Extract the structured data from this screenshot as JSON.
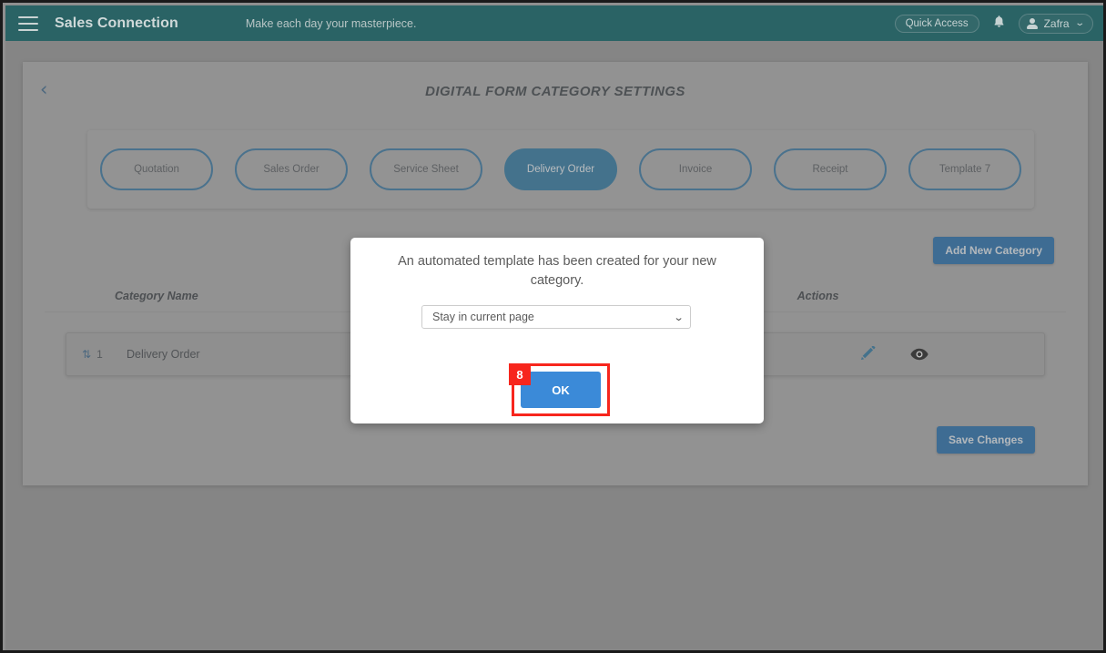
{
  "appbar": {
    "menu_icon": "hamburger-icon",
    "brand": "Sales Connection",
    "tagline": "Make each day your masterpiece.",
    "quick_access_label": "Quick Access",
    "bell_icon": "bell-icon",
    "user_name": "Zafra",
    "user_caret": "⌄",
    "colors": {
      "bar": "#2a6365",
      "text": "#c6d2d2"
    }
  },
  "page": {
    "back_icon": "‹",
    "title": "DIGITAL FORM CATEGORY SETTINGS"
  },
  "categories": {
    "pills": [
      {
        "label": "Quotation",
        "active": false
      },
      {
        "label": "Sales Order",
        "active": false
      },
      {
        "label": "Service Sheet",
        "active": false
      },
      {
        "label": "Delivery Order",
        "active": true
      },
      {
        "label": "Invoice",
        "active": false
      },
      {
        "label": "Receipt",
        "active": false
      },
      {
        "label": "Template 7",
        "active": false
      }
    ],
    "accent_color": "#1f6e9c"
  },
  "toolbar": {
    "add_new_category_label": "Add New Category",
    "save_changes_label": "Save Changes",
    "button_color": "#1565a8"
  },
  "table": {
    "headers": {
      "category_name": "Category Name",
      "actions": "Actions"
    },
    "rows": [
      {
        "order": "1",
        "sort_glyph": "⇅",
        "name": "Delivery Order",
        "actions": [
          "edit-pencil-icon",
          "view-eye-icon"
        ]
      }
    ]
  },
  "modal": {
    "message": "An automated template has been created for your new category.",
    "select": {
      "value": "Stay in current page",
      "caret": "⌄",
      "options": [
        "Stay in current page"
      ]
    },
    "ok_label": "OK",
    "ok_color": "#3b8ad8"
  },
  "annotation": {
    "step_number": "8",
    "highlight_color": "#f7261d"
  }
}
